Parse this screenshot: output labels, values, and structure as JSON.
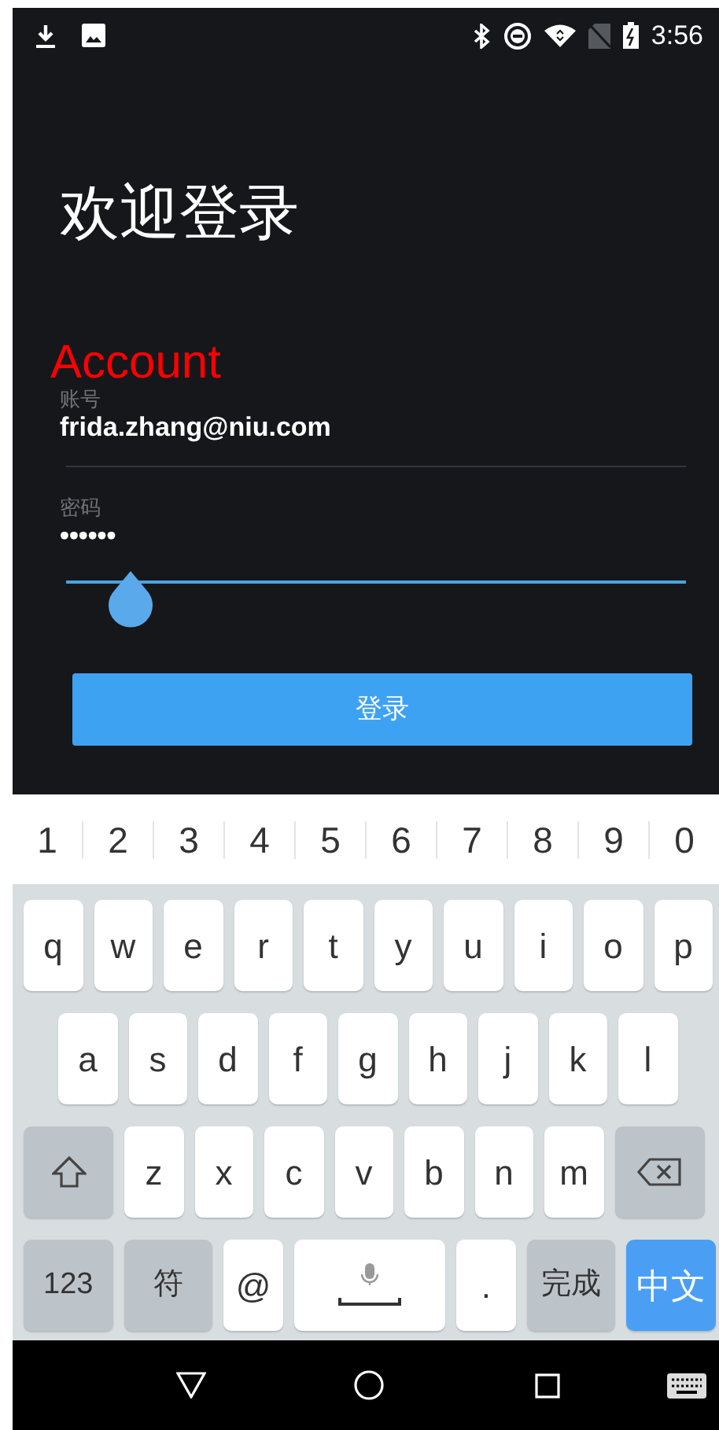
{
  "status_bar": {
    "time": "3:56"
  },
  "login": {
    "title": "欢迎登录",
    "annotation": "Account",
    "fields": [
      {
        "label": "账号",
        "value": "frida.zhang@niu.com",
        "focused": false
      },
      {
        "label": "密码",
        "value": "••••••",
        "focused": true
      }
    ],
    "submit": "登录"
  },
  "keyboard": {
    "number_row": [
      "1",
      "2",
      "3",
      "4",
      "5",
      "6",
      "7",
      "8",
      "9",
      "0"
    ],
    "rows": [
      {
        "keys": [
          {
            "kind": "letter",
            "label": "q"
          },
          {
            "kind": "letter",
            "label": "w"
          },
          {
            "kind": "letter",
            "label": "e"
          },
          {
            "kind": "letter",
            "label": "r"
          },
          {
            "kind": "letter",
            "label": "t"
          },
          {
            "kind": "letter",
            "label": "y"
          },
          {
            "kind": "letter",
            "label": "u"
          },
          {
            "kind": "letter",
            "label": "i"
          },
          {
            "kind": "letter",
            "label": "o"
          },
          {
            "kind": "letter",
            "label": "p"
          }
        ]
      },
      {
        "keys": [
          {
            "kind": "letter",
            "label": "a"
          },
          {
            "kind": "letter",
            "label": "s"
          },
          {
            "kind": "letter",
            "label": "d"
          },
          {
            "kind": "letter",
            "label": "f"
          },
          {
            "kind": "letter",
            "label": "g"
          },
          {
            "kind": "letter",
            "label": "h"
          },
          {
            "kind": "letter",
            "label": "j"
          },
          {
            "kind": "letter",
            "label": "k"
          },
          {
            "kind": "letter",
            "label": "l"
          }
        ]
      },
      {
        "keys": [
          {
            "kind": "shift"
          },
          {
            "kind": "letter",
            "label": "z"
          },
          {
            "kind": "letter",
            "label": "x"
          },
          {
            "kind": "letter",
            "label": "c"
          },
          {
            "kind": "letter",
            "label": "v"
          },
          {
            "kind": "letter",
            "label": "b"
          },
          {
            "kind": "letter",
            "label": "n"
          },
          {
            "kind": "letter",
            "label": "m"
          },
          {
            "kind": "backspace"
          }
        ]
      },
      {
        "keys": [
          {
            "kind": "function",
            "label": "123"
          },
          {
            "kind": "function",
            "label": "符"
          },
          {
            "kind": "letter",
            "label": "@"
          },
          {
            "kind": "space"
          },
          {
            "kind": "letter",
            "label": "."
          },
          {
            "kind": "function",
            "label": "完成"
          },
          {
            "kind": "primary",
            "label": "中文"
          }
        ]
      }
    ]
  }
}
